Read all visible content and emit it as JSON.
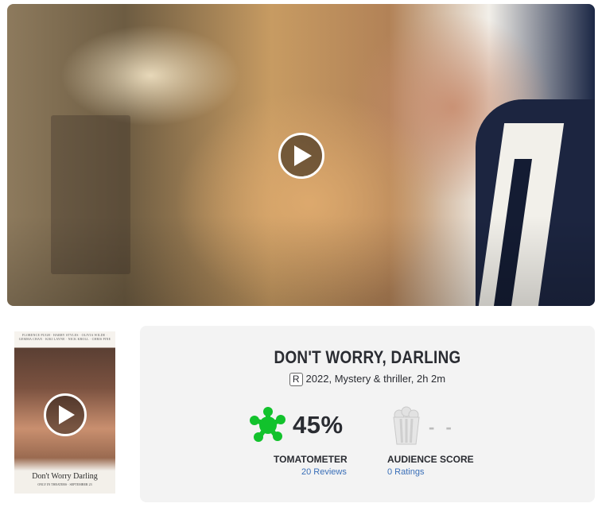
{
  "hero": {
    "play_icon": "play-icon"
  },
  "poster": {
    "cast_names": "FLORENCE PUGH · HARRY STYLES · OLIVIA WILDE · GEMMA CHAN · KIKI LAYNE · NICK KROLL · CHRIS PINE",
    "title": "Don't Worry Darling",
    "subtitle": "ONLY IN THEATERS · SEPTEMBER 23",
    "play_icon": "play-icon"
  },
  "movie": {
    "title": "DON'T WORRY, DARLING",
    "rating": "R",
    "info": "2022, Mystery & thriller, 2h 2m"
  },
  "scores": {
    "tomatometer": {
      "icon": "rotten-splat-icon",
      "value": "45%",
      "label": "TOMATOMETER",
      "link": "20 Reviews",
      "color": "#12c22c"
    },
    "audience": {
      "icon": "popcorn-empty-icon",
      "value": "- -",
      "label": "AUDIENCE SCORE",
      "link": "0 Ratings",
      "color": "#bcbcbc"
    }
  }
}
